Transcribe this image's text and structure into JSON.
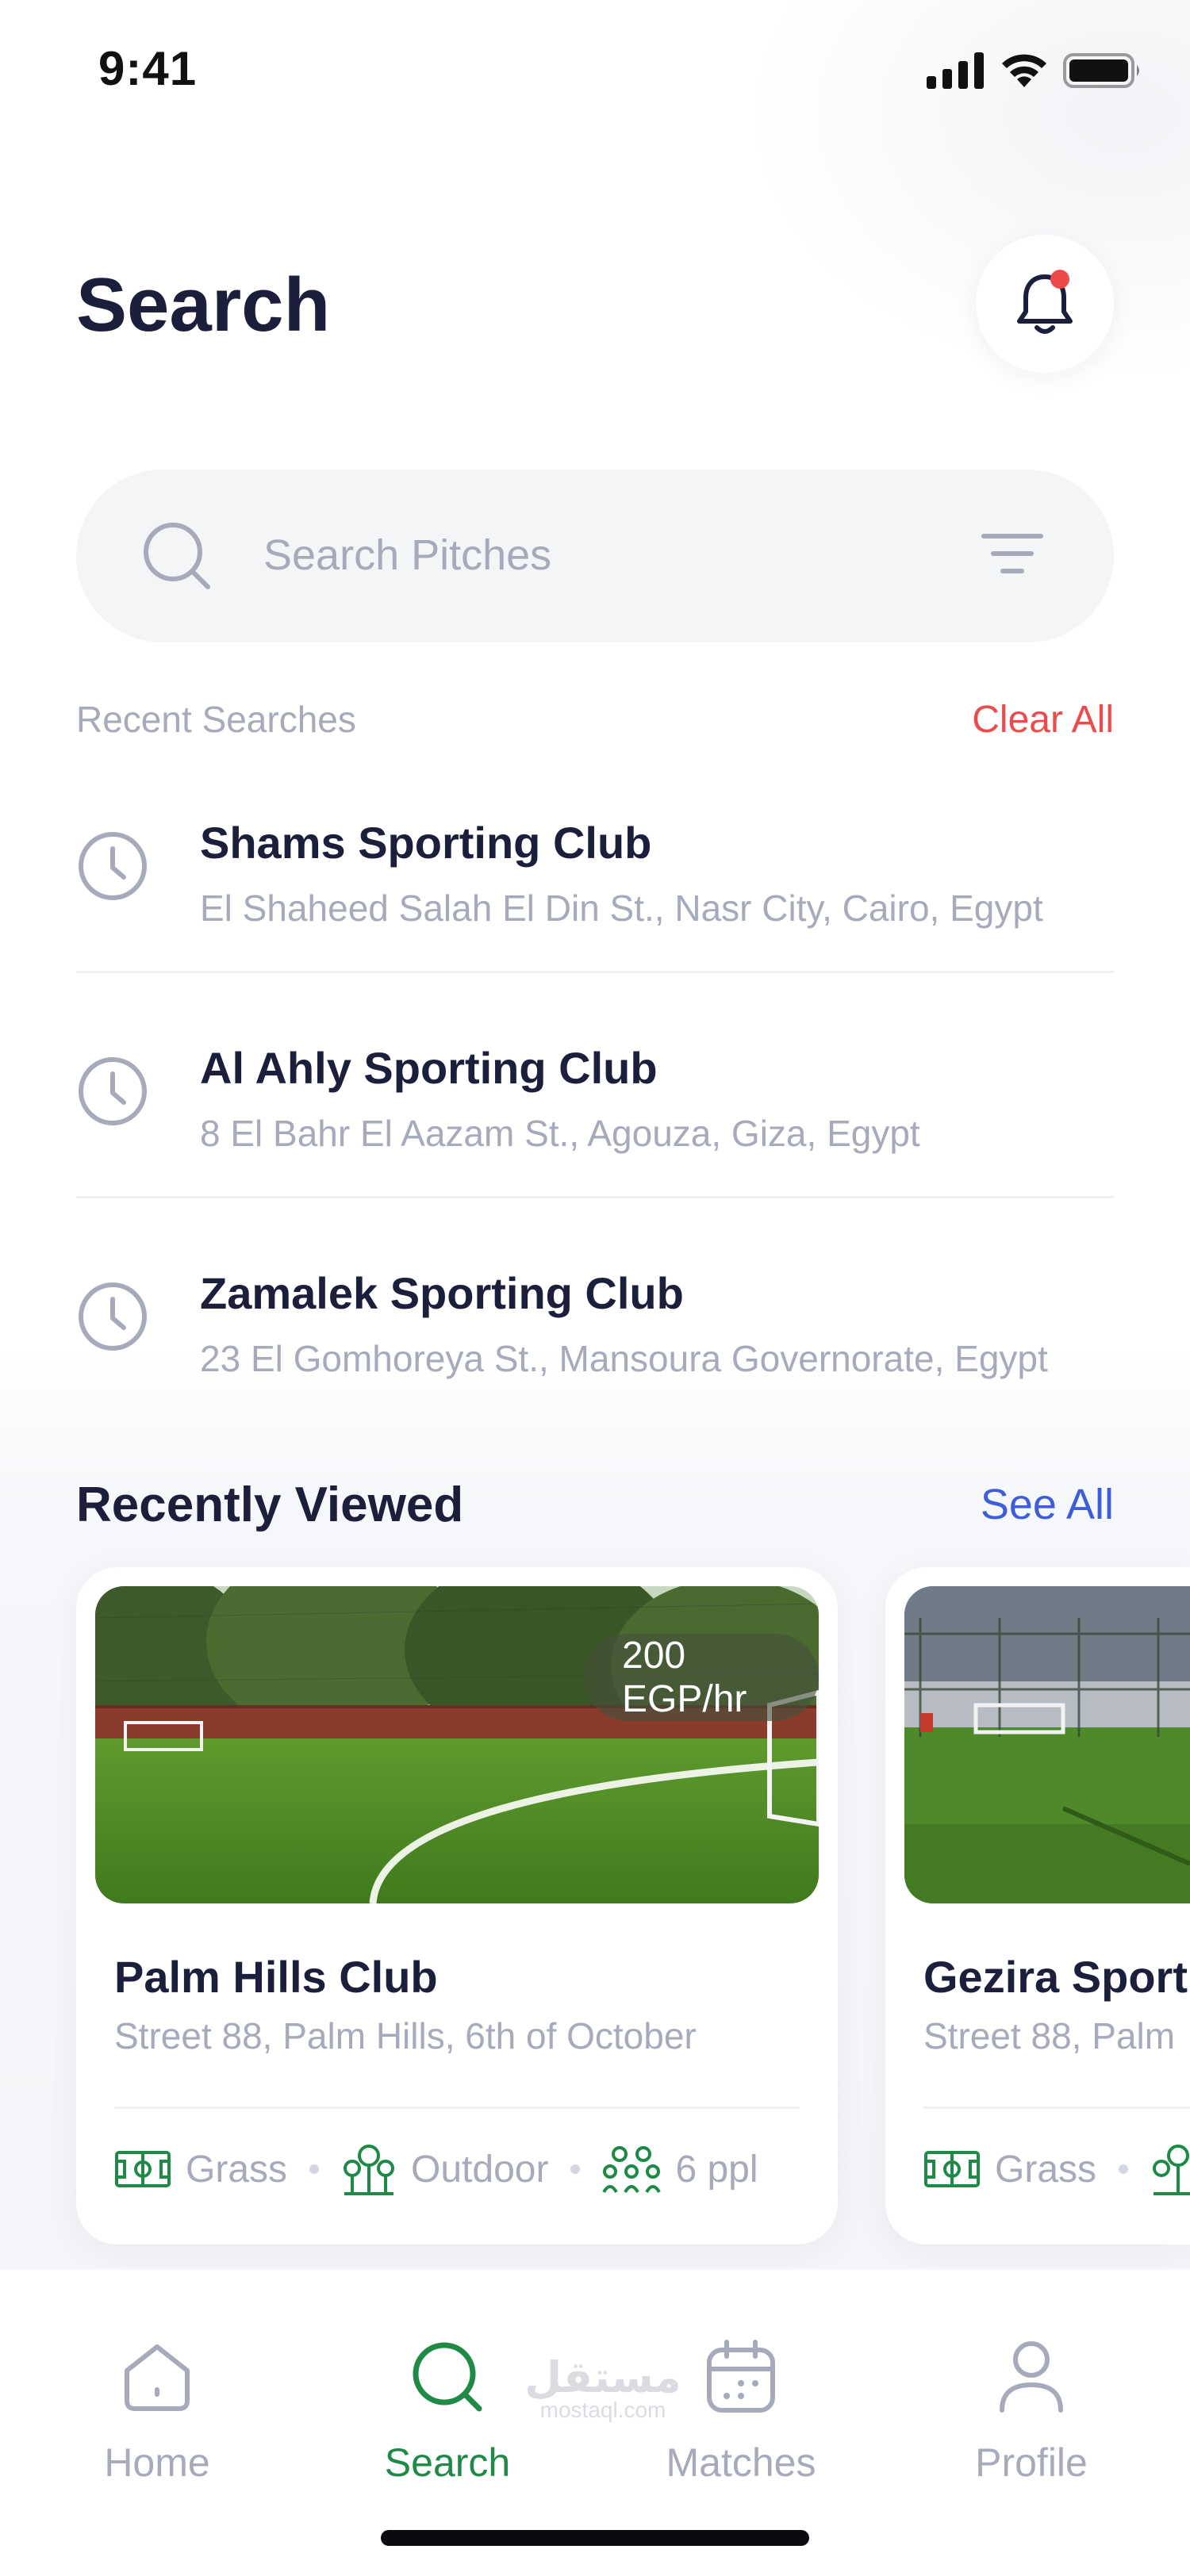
{
  "status_bar": {
    "time": "9:41"
  },
  "header": {
    "title": "Search"
  },
  "search": {
    "placeholder": "Search Pitches"
  },
  "recent": {
    "label": "Recent Searches",
    "clear_label": "Clear All",
    "items": [
      {
        "name": "Shams Sporting Club",
        "address": "El Shaheed Salah El Din St., Nasr City, Cairo, Egypt"
      },
      {
        "name": "Al Ahly Sporting Club",
        "address": "8 El Bahr El Aazam St., Agouza, Giza, Egypt"
      },
      {
        "name": "Zamalek Sporting Club",
        "address": "23 El Gomhoreya St., Mansoura Governorate, Egypt"
      }
    ]
  },
  "recently_viewed": {
    "title": "Recently Viewed",
    "see_all_label": "See All",
    "cards": [
      {
        "price": "200 EGP/hr",
        "name": "Palm Hills Club",
        "address": "Street 88, Palm Hills, 6th of October",
        "surface": "Grass",
        "setting": "Outdoor",
        "capacity": "6 ppl"
      },
      {
        "name": "Gezira Sport",
        "address": "Street 88, Palm",
        "surface": "Grass"
      }
    ]
  },
  "tabs": [
    {
      "label": "Home",
      "icon": "home-icon"
    },
    {
      "label": "Search",
      "icon": "search-icon",
      "active": true
    },
    {
      "label": "Matches",
      "icon": "calendar-icon"
    },
    {
      "label": "Profile",
      "icon": "user-icon"
    }
  ],
  "watermark": {
    "arabic": "مستقل",
    "latin": "mostaql.com"
  },
  "colors": {
    "accent_green": "#1E8A45",
    "alert_red": "#EB4B4B",
    "link_blue": "#3D5ED8",
    "muted": "#A6AABA",
    "ink": "#1B1F3B"
  }
}
